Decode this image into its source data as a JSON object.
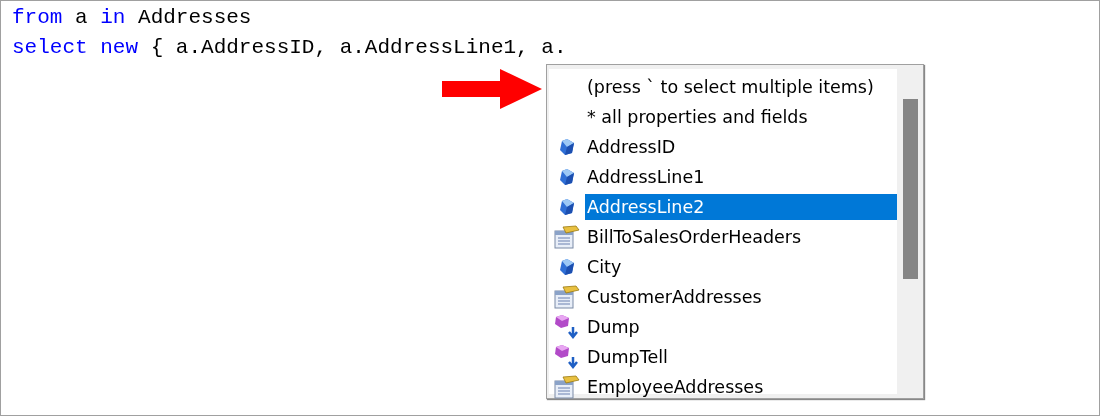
{
  "editor": {
    "lines": [
      [
        {
          "kind": "keyword",
          "text": "from"
        },
        {
          "kind": "plain",
          "text": " a "
        },
        {
          "kind": "keyword",
          "text": "in"
        },
        {
          "kind": "plain",
          "text": " Addresses"
        }
      ],
      [
        {
          "kind": "keyword",
          "text": "select new"
        },
        {
          "kind": "plain",
          "text": " { a.AddressID, a.AddressLine1, a."
        }
      ]
    ]
  },
  "completion_list": {
    "items": [
      {
        "kind": "hint",
        "label": "(press ` to select multiple items)",
        "selected": false
      },
      {
        "kind": "hint",
        "label": "* all properties and fields",
        "selected": false
      },
      {
        "kind": "property",
        "label": "AddressID",
        "selected": false
      },
      {
        "kind": "property",
        "label": "AddressLine1",
        "selected": false
      },
      {
        "kind": "property",
        "label": "AddressLine2",
        "selected": true
      },
      {
        "kind": "table",
        "label": "BillToSalesOrderHeaders",
        "selected": false
      },
      {
        "kind": "property",
        "label": "City",
        "selected": false
      },
      {
        "kind": "table",
        "label": "CustomerAddresses",
        "selected": false
      },
      {
        "kind": "method",
        "label": "Dump",
        "selected": false
      },
      {
        "kind": "method",
        "label": "DumpTell",
        "selected": false
      },
      {
        "kind": "table",
        "label": "EmployeeAddresses",
        "selected": false
      }
    ]
  }
}
